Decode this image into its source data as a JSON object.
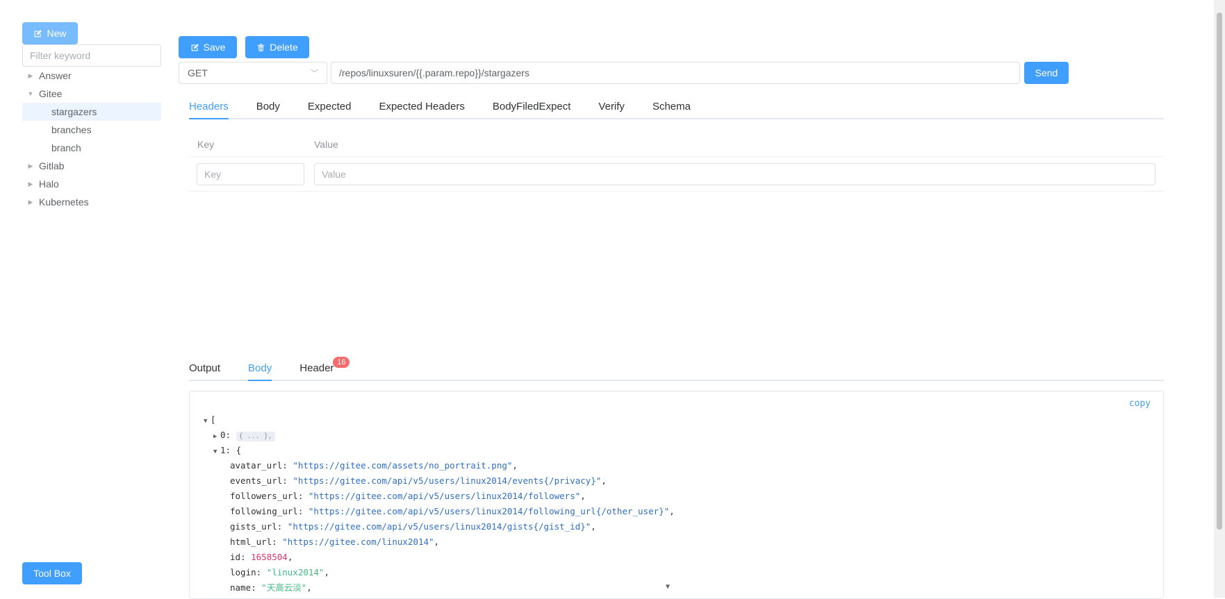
{
  "sidebar": {
    "new_label": "New",
    "filter_placeholder": "Filter keyword",
    "tree": [
      {
        "label": "Answer",
        "expanded": false
      },
      {
        "label": "Gitee",
        "expanded": true
      },
      {
        "label": "stargazers",
        "child": true,
        "selected": true
      },
      {
        "label": "branches",
        "child": true
      },
      {
        "label": "branch",
        "child": true
      },
      {
        "label": "Gitlab",
        "expanded": false
      },
      {
        "label": "Halo",
        "expanded": false
      },
      {
        "label": "Kubernetes",
        "expanded": false
      }
    ],
    "toolbox_label": "Tool Box"
  },
  "toolbar": {
    "save_label": "Save",
    "delete_label": "Delete"
  },
  "request": {
    "method": "GET",
    "url": "/repos/linuxsuren/{{.param.repo}}/stargazers",
    "send_label": "Send",
    "tabs": [
      "Headers",
      "Body",
      "Expected",
      "Expected Headers",
      "BodyFiledExpect",
      "Verify",
      "Schema"
    ],
    "active_tab": "Headers",
    "headers_table": {
      "key_header": "Key",
      "value_header": "Value",
      "key_placeholder": "Key",
      "value_placeholder": "Value"
    }
  },
  "response": {
    "tabs": [
      "Output",
      "Body",
      "Header"
    ],
    "active_tab": "Body",
    "header_count": "16",
    "copy_label": "copy",
    "json": {
      "open_bracket": "[",
      "item0_index": "0:",
      "item0_collapsed": "{ ... },",
      "item1_index": "1:",
      "item1_open": "{",
      "fields": [
        {
          "key": "avatar_url",
          "value": "\"https://gitee.com/assets/no_portrait.png\"",
          "type": "string"
        },
        {
          "key": "events_url",
          "value": "\"https://gitee.com/api/v5/users/linux2014/events{/privacy}\"",
          "type": "string"
        },
        {
          "key": "followers_url",
          "value": "\"https://gitee.com/api/v5/users/linux2014/followers\"",
          "type": "string"
        },
        {
          "key": "following_url",
          "value": "\"https://gitee.com/api/v5/users/linux2014/following_url{/other_user}\"",
          "type": "string"
        },
        {
          "key": "gists_url",
          "value": "\"https://gitee.com/api/v5/users/linux2014/gists{/gist_id}\"",
          "type": "string"
        },
        {
          "key": "html_url",
          "value": "\"https://gitee.com/linux2014\"",
          "type": "string"
        },
        {
          "key": "id",
          "value": "1658504",
          "type": "number"
        },
        {
          "key": "login",
          "value": "\"linux2014\"",
          "type": "green"
        },
        {
          "key": "name",
          "value": "\"天高云淡\"",
          "type": "green"
        }
      ]
    }
  }
}
